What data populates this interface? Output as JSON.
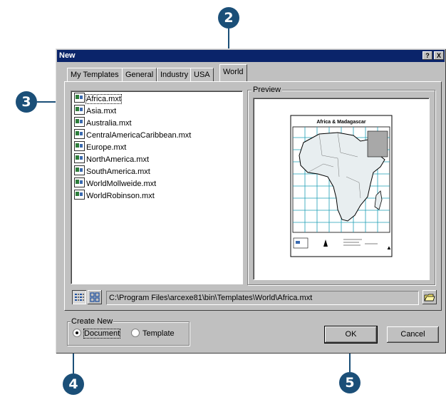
{
  "callouts": [
    "2",
    "3",
    "4",
    "5"
  ],
  "dialog": {
    "title": "New",
    "help_label": "?",
    "close_label": "X"
  },
  "tabs": [
    {
      "label": "My Templates"
    },
    {
      "label": "General"
    },
    {
      "label": "Industry"
    },
    {
      "label": "USA"
    },
    {
      "label": "World",
      "active": true
    }
  ],
  "files": [
    {
      "name": "Africa.mxt",
      "selected": true
    },
    {
      "name": "Asia.mxt"
    },
    {
      "name": "Australia.mxt"
    },
    {
      "name": "CentralAmericaCaribbean.mxt"
    },
    {
      "name": "Europe.mxt"
    },
    {
      "name": "NorthAmerica.mxt"
    },
    {
      "name": "SouthAmerica.mxt"
    },
    {
      "name": "WorldMollweide.mxt"
    },
    {
      "name": "WorldRobinson.mxt"
    }
  ],
  "preview": {
    "label": "Preview",
    "map_title": "Africa & Madagascar"
  },
  "path": "C:\\Program Files\\arcexe81\\bin\\Templates\\World\\Africa.mxt",
  "create_new": {
    "label": "Create New",
    "options": [
      {
        "label": "Document",
        "selected": true
      },
      {
        "label": "Template",
        "selected": false
      }
    ]
  },
  "buttons": {
    "ok": "OK",
    "cancel": "Cancel"
  },
  "icons": {
    "file": "map-template-icon",
    "list_view": "list-view-icon",
    "large_icons": "large-icons-view-icon",
    "browse": "open-folder-icon"
  },
  "colors": {
    "callout": "#1b4f78",
    "title_bar": "#0a246a",
    "dialog_face": "#c0c0c0",
    "map_grid": "#1e9fb5"
  }
}
